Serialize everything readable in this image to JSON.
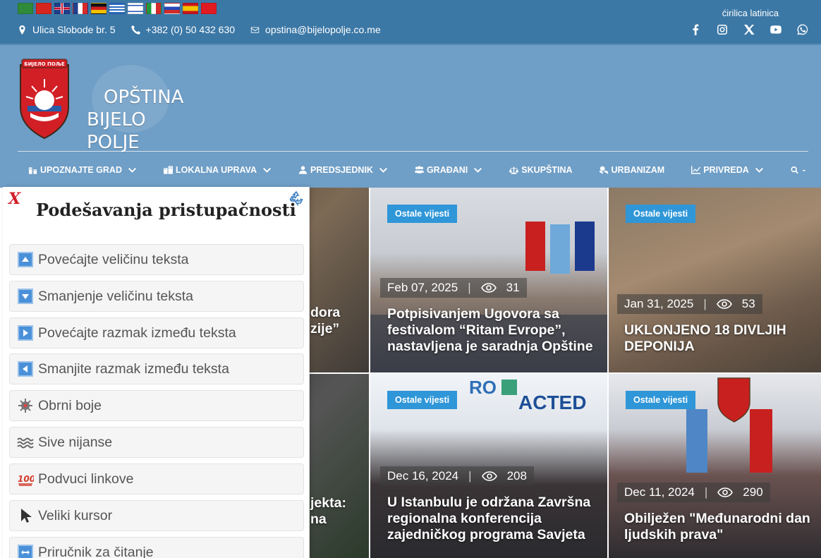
{
  "topbar": {
    "flags": [
      "ar",
      "cn",
      "gb",
      "fr",
      "de",
      "gr",
      "il",
      "it",
      "ru",
      "es",
      "tr"
    ],
    "address": "Ulica Slobode br. 5",
    "phone": "+382 (0) 50 432 630",
    "email": "opstina@bijelopolje.co.me",
    "script_toggle": "ćirilica latinica",
    "social": [
      "facebook-icon",
      "instagram-icon",
      "x-icon",
      "youtube-icon",
      "whatsapp-icon"
    ]
  },
  "header": {
    "logo_line1": "OPŠTINA",
    "logo_line2": "BIJELO POLJE",
    "nav": [
      {
        "label": "UPOZNAJTE GRAD",
        "icon": "building-icon",
        "dropdown": true
      },
      {
        "label": "LOKALNA UPRAVA",
        "icon": "city-icon",
        "dropdown": true
      },
      {
        "label": "PREDSJEDNIK",
        "icon": "user-icon",
        "dropdown": true
      },
      {
        "label": "GRAĐANI",
        "icon": "users-icon",
        "dropdown": true
      },
      {
        "label": "SKUPŠTINA",
        "icon": "scale-icon",
        "dropdown": false
      },
      {
        "label": "URBANIZAM",
        "icon": "cubes-icon",
        "dropdown": false
      },
      {
        "label": "PRIVREDA",
        "icon": "chart-icon",
        "dropdown": true
      },
      {
        "label": "-",
        "icon": "search-icon",
        "dropdown": false
      }
    ]
  },
  "news": [
    {
      "badge": "Ostale vijesti",
      "date": "Feb 07, 2025",
      "views": "31",
      "title": "Potpisivanjem Ugovora sa festivalom “Ritam Evrope”, nastavljena je saradnja Opštine"
    },
    {
      "badge": "Ostale vijesti",
      "date": "Jan 31, 2025",
      "views": "53",
      "title": "UKLONJENO 18 DIVLJIH DEPONIJA"
    },
    {
      "badge": "Ostale vijesti",
      "date": "Dec 16, 2024",
      "views": "208",
      "title": "U Istanbulu je održana Završna regionalna konferencija zajedničkog programa Savjeta"
    },
    {
      "badge": "Ostale vijesti",
      "date": "Dec 11, 2024",
      "views": "290",
      "title": "Obilježen \"Međunarodni dan ljudskih prava\""
    }
  ],
  "partial_titles": {
    "top_left": "dora\nzije”",
    "bottom_left": "jekta:\nna"
  },
  "panel": {
    "close": "X",
    "title": "Podešavanja pristupačnosti",
    "options": [
      "Povećajte veličinu teksta",
      "Smanjenje veličinu teksta",
      "Povećajte razmak između teksta",
      "Smanjite razmak između teksta",
      "Obrni boje",
      "Sive nijanse",
      "Podvuci linkove",
      "Veliki kursor",
      "Priručnik za čitanje"
    ]
  }
}
